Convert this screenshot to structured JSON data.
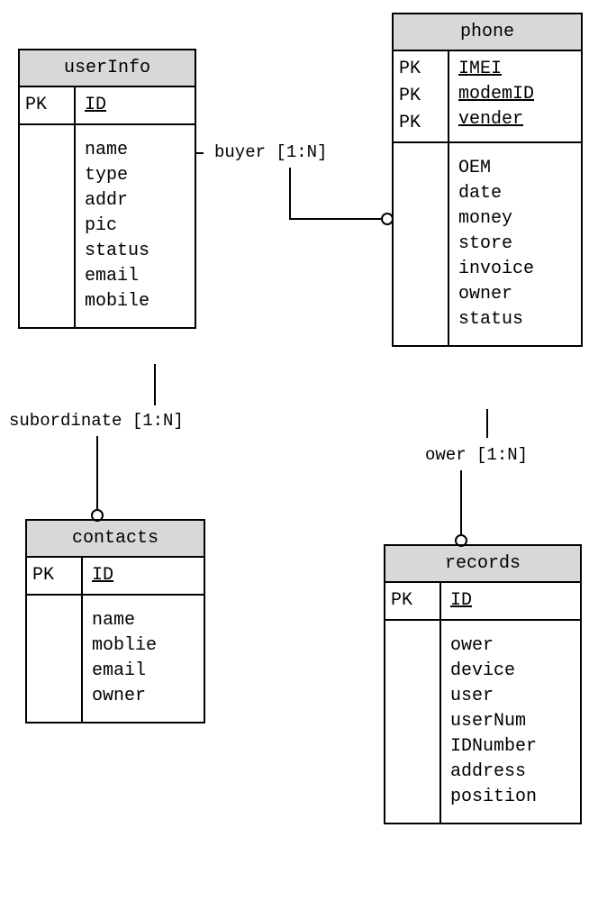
{
  "entities": {
    "userInfo": {
      "title": "userInfo",
      "pk_labels": [
        "PK"
      ],
      "pk_attrs": [
        "ID"
      ],
      "attrs": [
        "name",
        "type",
        "addr",
        "pic",
        "status",
        "email",
        "mobile"
      ]
    },
    "phone": {
      "title": "phone",
      "pk_labels": [
        "PK",
        "PK",
        "PK"
      ],
      "pk_attrs": [
        "IMEI",
        "modemID",
        "vender"
      ],
      "attrs": [
        "OEM",
        "date",
        "money",
        "store",
        "invoice",
        "owner",
        "status"
      ]
    },
    "contacts": {
      "title": "contacts",
      "pk_labels": [
        "PK"
      ],
      "pk_attrs": [
        "ID"
      ],
      "attrs": [
        "name",
        "moblie",
        "email",
        "owner"
      ]
    },
    "records": {
      "title": "records",
      "pk_labels": [
        "PK"
      ],
      "pk_attrs": [
        "ID"
      ],
      "attrs": [
        "ower",
        "device",
        "user",
        "userNum",
        "IDNumber",
        "address",
        "position"
      ]
    }
  },
  "relationships": {
    "buyer": {
      "label": "buyer [1:N]"
    },
    "subordinate": {
      "label": "subordinate [1:N]"
    },
    "ower": {
      "label": "ower [1:N]"
    }
  }
}
